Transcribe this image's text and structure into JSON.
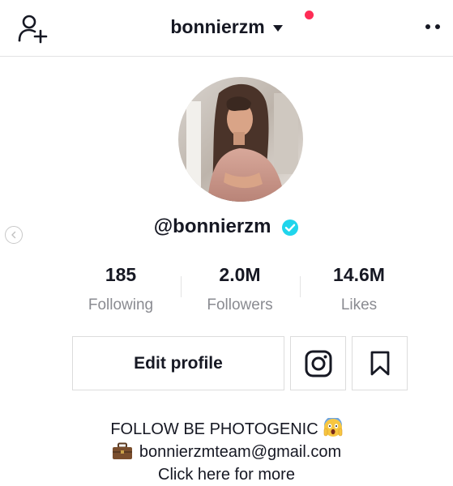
{
  "header": {
    "username": "bonnierzm",
    "add_user_icon": "add-user-icon",
    "dropdown_icon": "caret-down-icon",
    "more_icon": "more-icon",
    "accent": "#fe2c55"
  },
  "profile": {
    "handle": "@bonnierzm",
    "verified_icon": "verified-badge-icon",
    "verified_color": "#20d5ec"
  },
  "stats": [
    {
      "value": "185",
      "label": "Following"
    },
    {
      "value": "2.0M",
      "label": "Followers"
    },
    {
      "value": "14.6M",
      "label": "Likes"
    }
  ],
  "actions": {
    "edit_label": "Edit profile",
    "instagram_icon": "instagram-icon",
    "bookmark_icon": "bookmark-icon"
  },
  "bio": {
    "line1": "FOLLOW BE PHOTOGENIC",
    "line1_emoji": "screaming-face-emoji",
    "line2": "bonnierzmteam@gmail.com",
    "line2_emoji": "briefcase-emoji",
    "line3": "Click here for more"
  }
}
